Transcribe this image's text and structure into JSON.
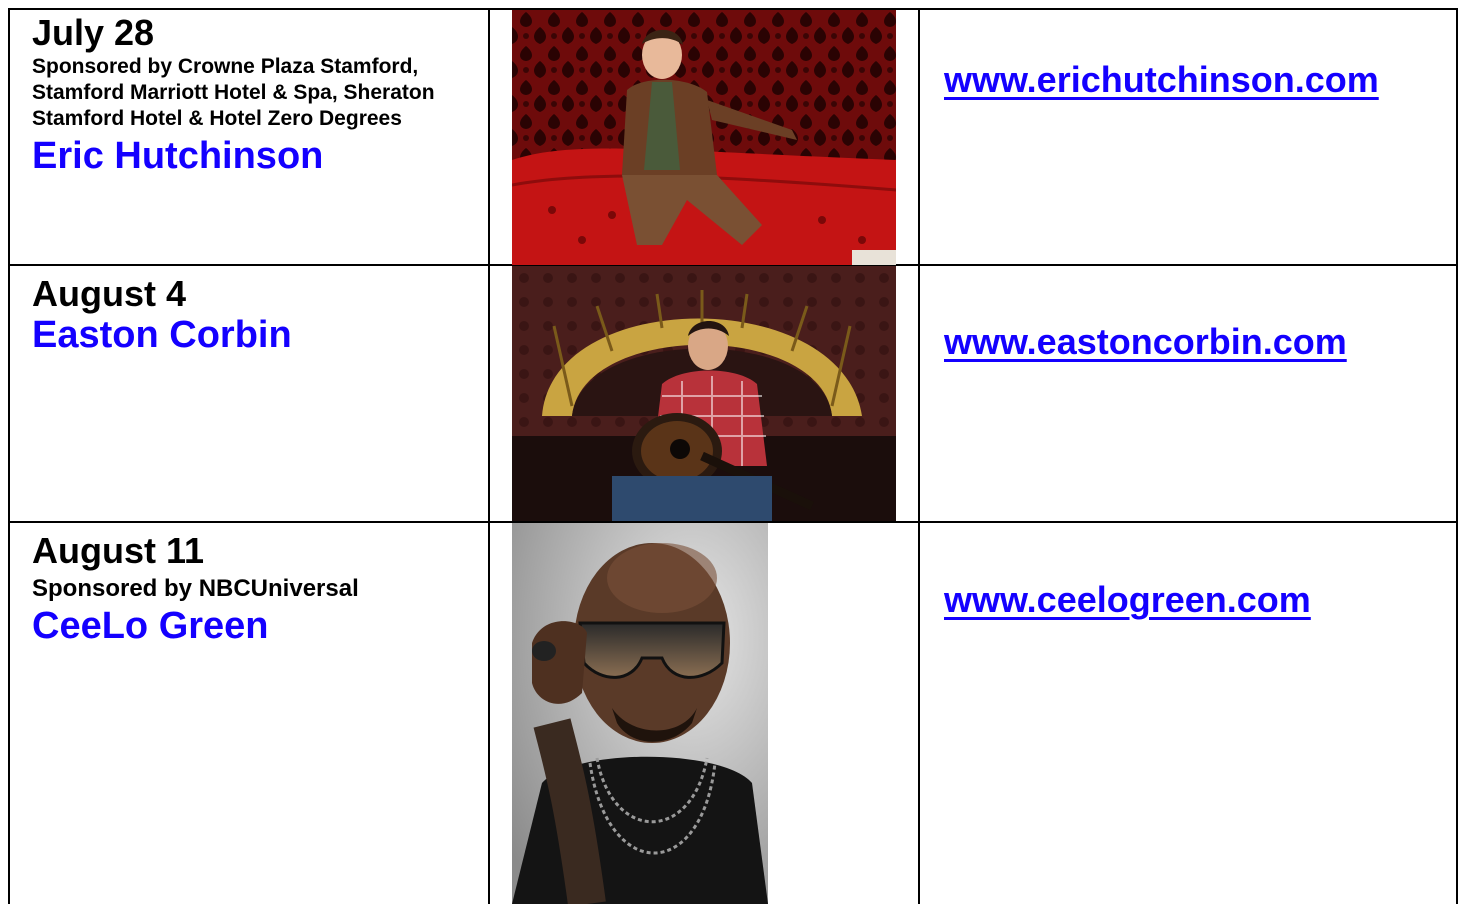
{
  "rows": [
    {
      "date": "July 28",
      "sponsor": "Sponsored by Crowne Plaza Stamford, Stamford Marriott Hotel & Spa, Sheraton Stamford Hotel & Hotel Zero Degrees",
      "artist": "Eric Hutchinson",
      "website": "www.erichutchinson.com",
      "photo_alt": "Eric Hutchinson photo"
    },
    {
      "date": "August 4",
      "artist": "Easton Corbin",
      "website": "www.eastoncorbin.com",
      "photo_alt": "Easton Corbin photo"
    },
    {
      "date": "August 11",
      "sponsor": "Sponsored by NBCUniversal",
      "artist": "CeeLo Green",
      "website": "www.ceelogreen.com",
      "photo_alt": "CeeLo Green photo"
    }
  ],
  "colors": {
    "artist": "#1400ff",
    "link": "#1400ff",
    "text": "#000000",
    "border": "#000000"
  }
}
